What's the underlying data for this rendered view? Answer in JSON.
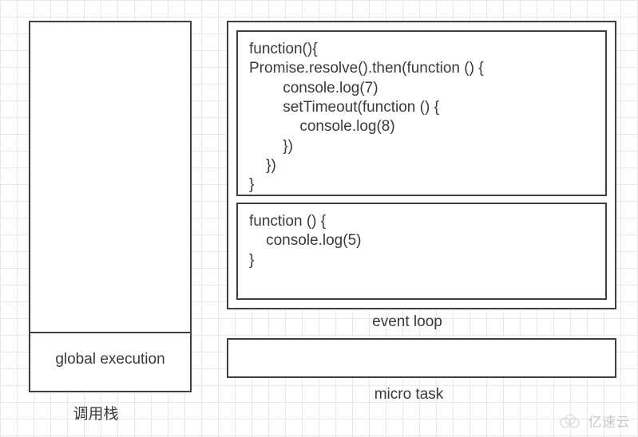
{
  "callstack": {
    "cell_label": "global execution",
    "caption": "调用栈"
  },
  "eventloop": {
    "label": "event loop",
    "code_block_1": "function(){\nPromise.resolve().then(function () {\n        console.log(7)\n        setTimeout(function () {\n            console.log(8)\n        })\n    })\n}",
    "code_block_2": "function () {\n    console.log(5)\n}"
  },
  "microtask": {
    "label": "micro task"
  },
  "watermark": {
    "text": "亿速云"
  }
}
